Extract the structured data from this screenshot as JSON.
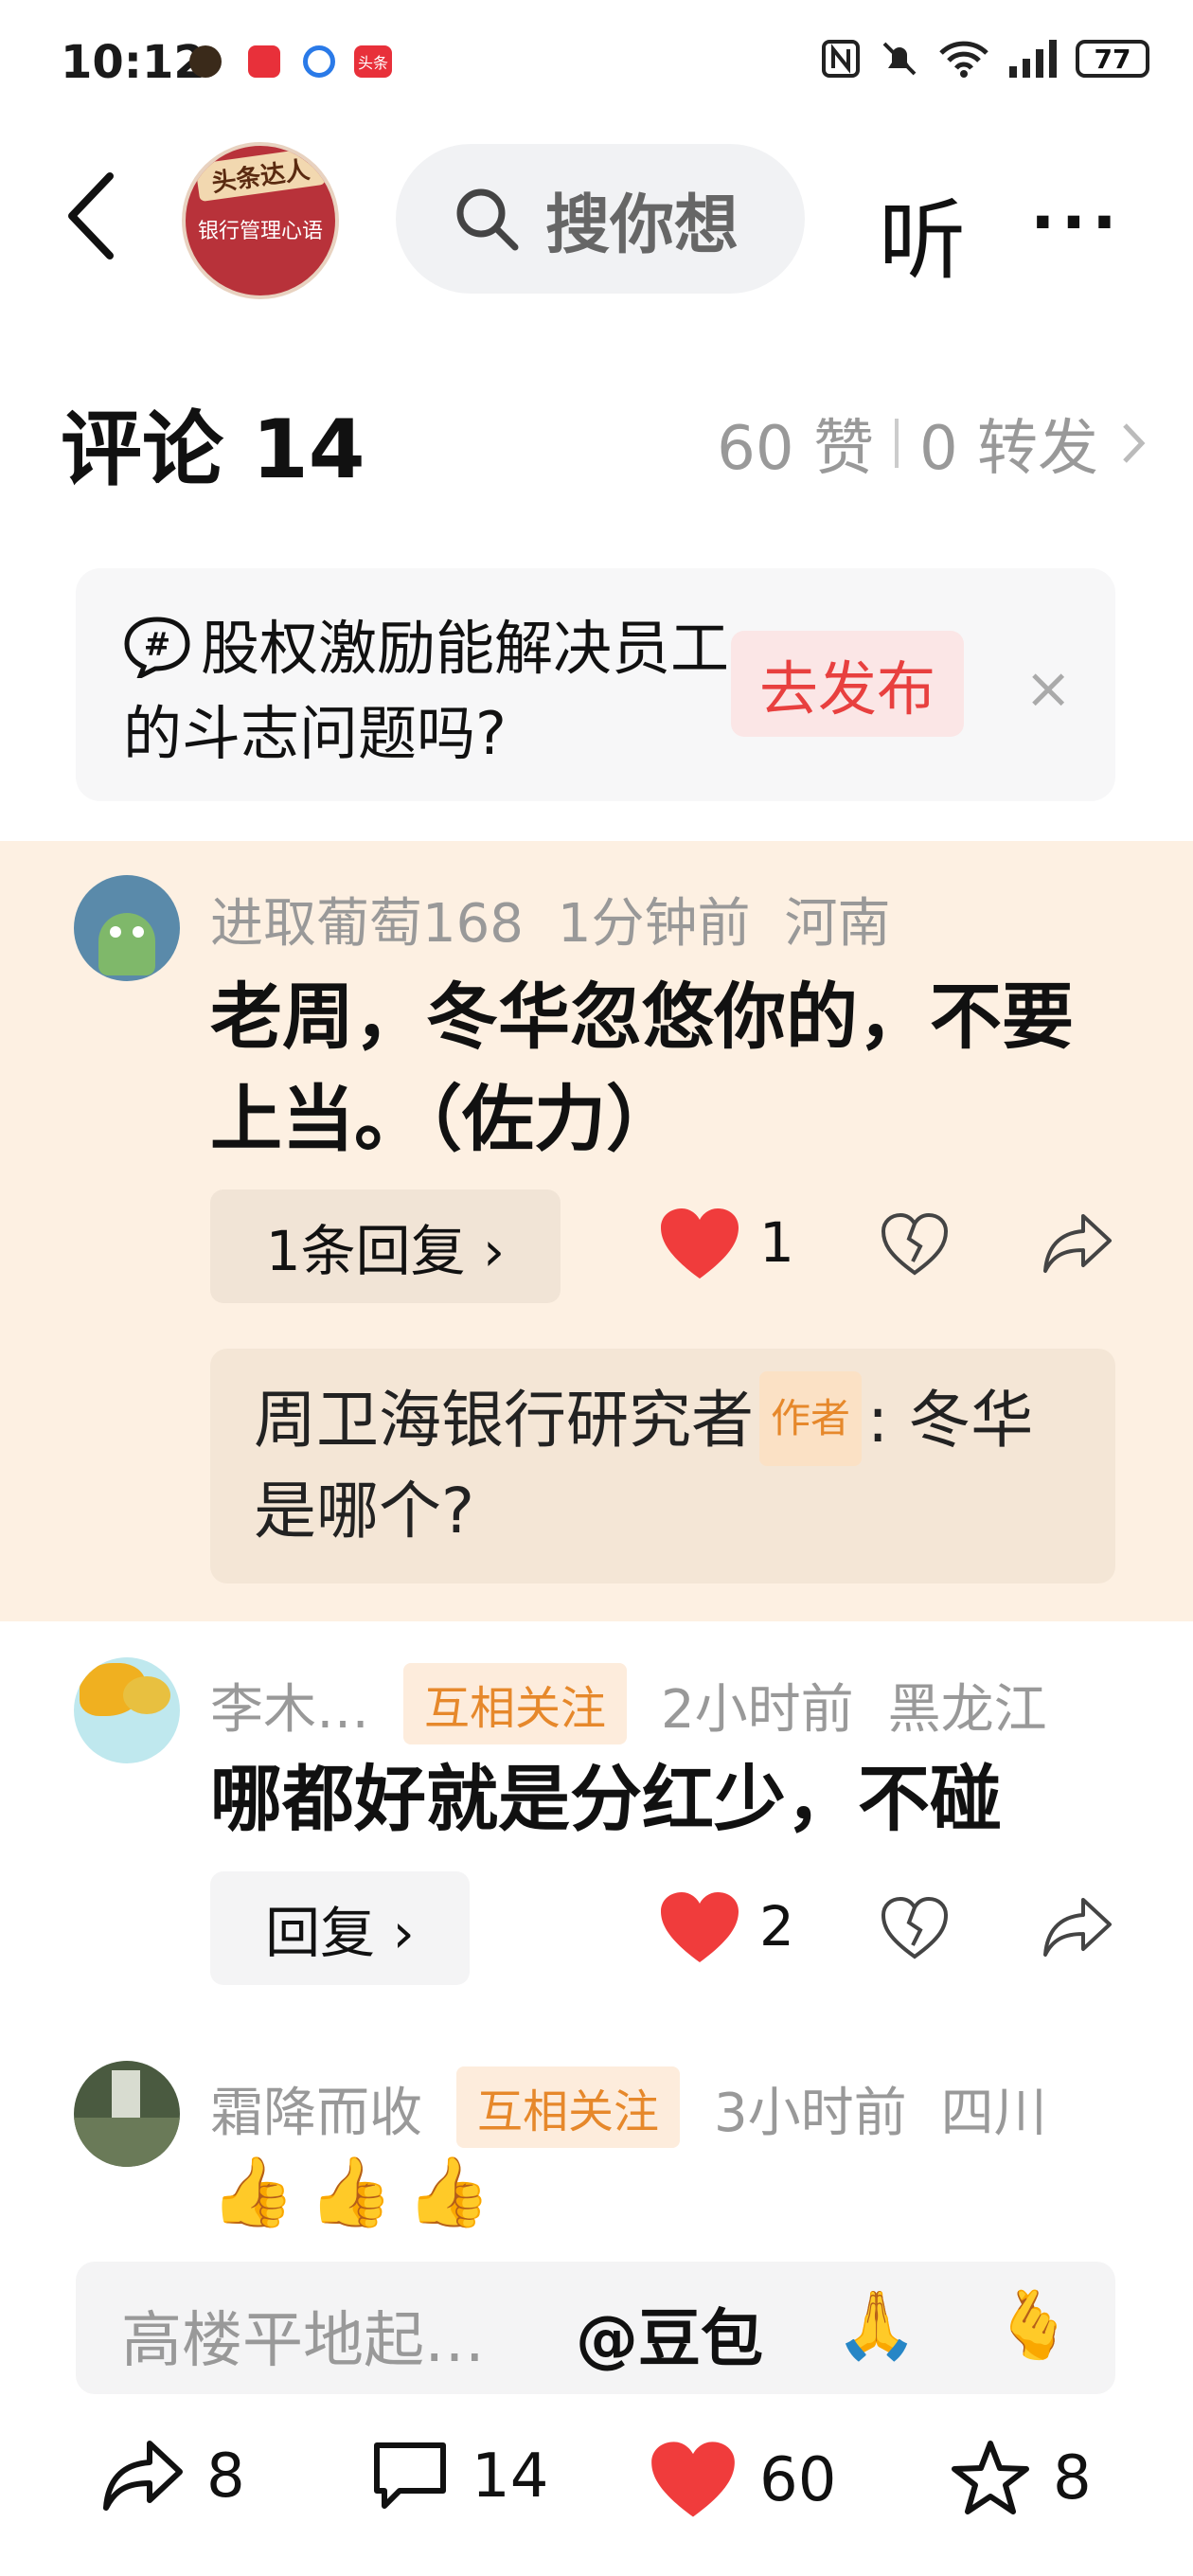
{
  "status_bar": {
    "time": "10:12",
    "battery": "77",
    "notif_app_icons": [
      "avatar-app-icon",
      "tv-app-icon",
      "browser-app-icon",
      "toutiao-app-icon"
    ],
    "toutiao_badge": "头条"
  },
  "header": {
    "avatar_banner": "头条达人",
    "avatar_book_title": "银行管理心语",
    "search_placeholder": "搜你想",
    "listen_label": "听",
    "more_label": "···"
  },
  "comments_header": {
    "title": "评论 14",
    "likes": "60 赞",
    "reposts": "0 转发"
  },
  "topic": {
    "text": "股权激励能解决员工的斗志问题吗?",
    "publish_label": "去发布",
    "close_label": "×"
  },
  "comments": [
    {
      "user": "进取葡萄168",
      "time": "1分钟前",
      "location": "河南",
      "body": "老周，冬华忽悠你的，不要上当。（佐力）",
      "reply_label": "1条回复 ›",
      "likes": "1",
      "author_reply": {
        "name": "周卫海银行研究者",
        "tag": "作者",
        "text": ": 冬华是哪个?"
      }
    },
    {
      "user": "李木…",
      "badge": "互相关注",
      "time": "2小时前",
      "location": "黑龙江",
      "body": "哪都好就是分红少，不碰",
      "reply_label": "回复 ›",
      "likes": "2"
    },
    {
      "user": "霜降而收",
      "badge": "互相关注",
      "time": "3小时前",
      "location": "四川",
      "body": "👍👍👍"
    }
  ],
  "input_bar": {
    "placeholder": "高楼平地起…",
    "mention": "@豆包",
    "emoji1": "🙏",
    "emoji2": "🫰"
  },
  "bottom_bar": {
    "share_count": "8",
    "comment_count": "14",
    "like_count": "60",
    "favorite_count": "8"
  },
  "colors": {
    "like_red": "#f03c3c",
    "highlight_bg": "#fdf0e2",
    "badge_orange": "#e6882b",
    "publish_red": "#e8403f"
  }
}
